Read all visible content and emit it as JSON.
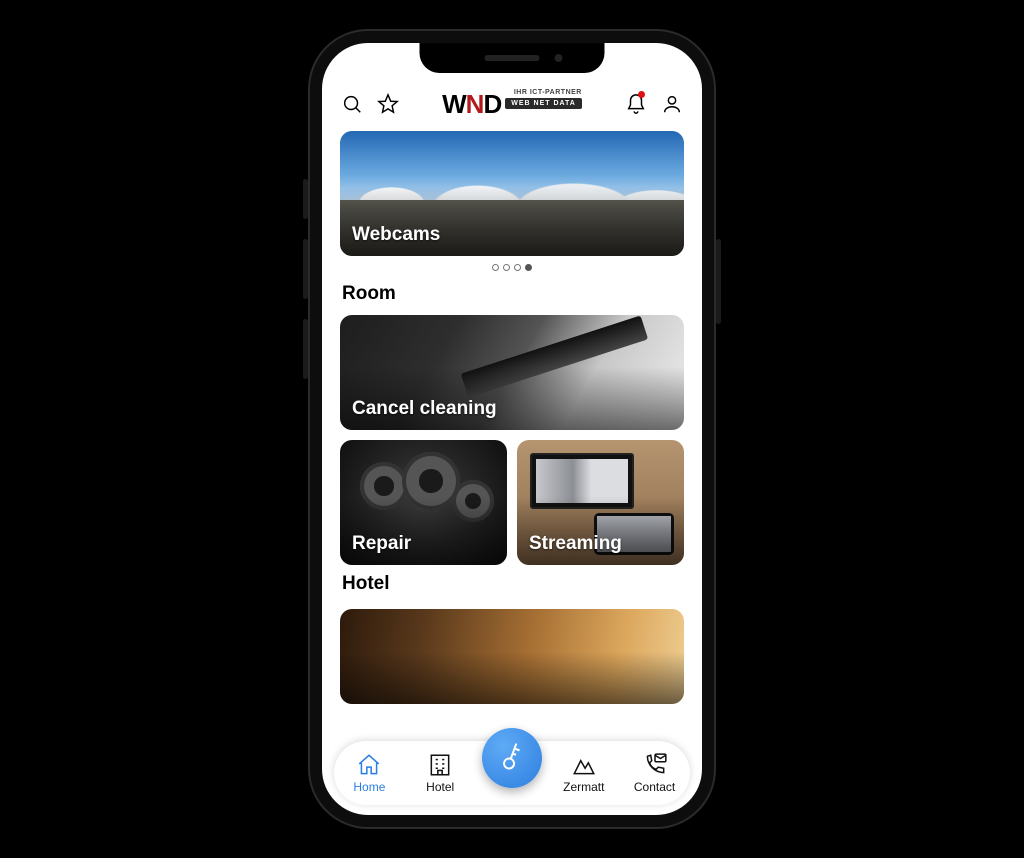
{
  "logo": {
    "top_line": "IHR ICT-PARTNER",
    "bottom_line": "WEB NET DATA"
  },
  "hero": {
    "label": "Webcams"
  },
  "pager": {
    "count": 4,
    "active": 3
  },
  "sections": {
    "room": {
      "title": "Room",
      "cancel": "Cancel cleaning",
      "repair": "Repair",
      "streaming": "Streaming"
    },
    "hotel": {
      "title": "Hotel"
    }
  },
  "nav": {
    "home": "Home",
    "hotel": "Hotel",
    "zermatt": "Zermatt",
    "contact": "Contact"
  },
  "colors": {
    "accent": "#2b7de1",
    "brand_red": "#b31a1a"
  }
}
